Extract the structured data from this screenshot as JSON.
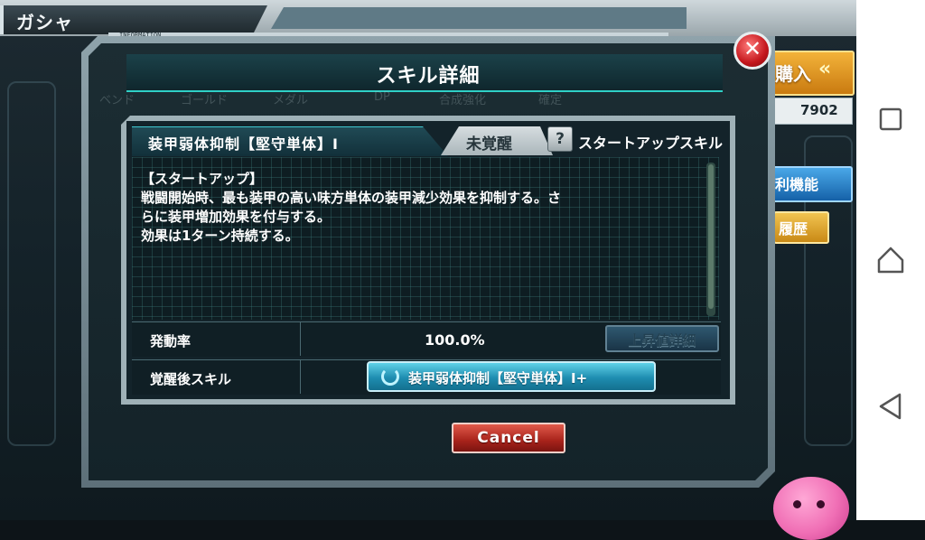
{
  "background": {
    "title": "ガシャ",
    "buy_button": "購入",
    "buy_arrows": "«",
    "coin_count": "7902",
    "function_button": "利機能",
    "history_button": "履歴",
    "ghost_tabs": [
      "ベンド",
      "ゴールド",
      "メダル",
      "DP",
      "合成強化",
      "確定"
    ]
  },
  "modal": {
    "info_label": "INFORMATION",
    "title": "スキル詳細",
    "close_glyph": "✕",
    "skill": {
      "name": "装甲弱体抑制【堅守単体】Ⅰ",
      "awake_status": "未覚醒",
      "help_glyph": "?",
      "type_label": "スタートアップスキル",
      "description": [
        "【スタートアップ】",
        "戦闘開始時、最も装甲の高い味方単体の装甲減少効果を抑制する。さ",
        "らに装甲増加効果を付与する。",
        "効果は1ターン持続する。"
      ]
    },
    "rows": {
      "rate_label": "発動率",
      "rate_value": "100.0%",
      "detail_button": "上昇値詳細",
      "awake_skill_label": "覚醒後スキル",
      "awake_skill_button": "装甲弱体抑制【堅守単体】Ⅰ+"
    },
    "cancel_button": "Cancel"
  },
  "colors": {
    "accent_teal": "#2fd0c6",
    "cancel_red": "#a8231b",
    "awake_button_blue": "#1e8db0"
  }
}
